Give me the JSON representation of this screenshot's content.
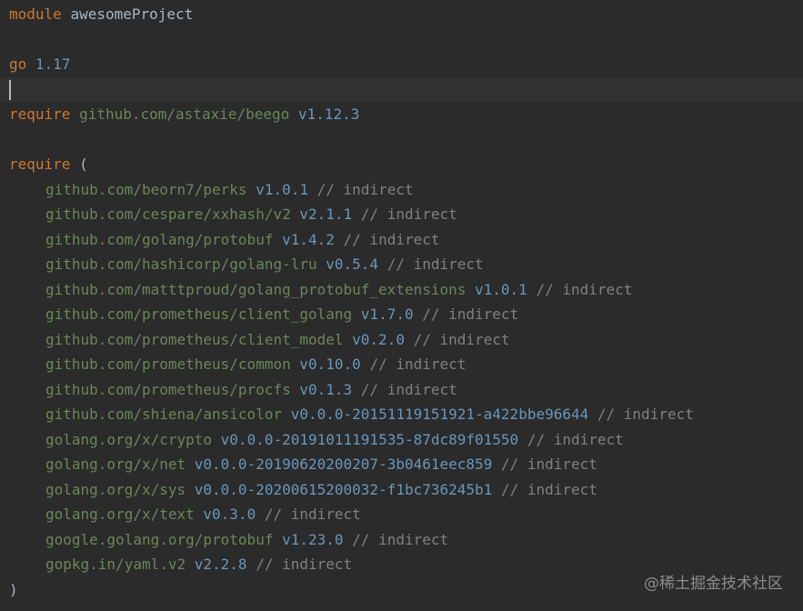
{
  "editor": {
    "module_line": {
      "keyword": "module",
      "name": "awesomeProject"
    },
    "go_line": {
      "keyword": "go",
      "version": "1.17"
    },
    "require_single": {
      "keyword": "require",
      "path": "github.com/astaxie/beego",
      "version": "v1.12.3"
    },
    "require_block_open": {
      "keyword": "require",
      "paren": "("
    },
    "require_block_close": ")",
    "deps": [
      {
        "path": "github.com/beorn7/perks",
        "version": "v1.0.1",
        "comment": "// indirect"
      },
      {
        "path": "github.com/cespare/xxhash/v2",
        "version": "v2.1.1",
        "comment": "// indirect"
      },
      {
        "path": "github.com/golang/protobuf",
        "version": "v1.4.2",
        "comment": "// indirect"
      },
      {
        "path": "github.com/hashicorp/golang-lru",
        "version": "v0.5.4",
        "comment": "// indirect"
      },
      {
        "path": "github.com/matttproud/golang_protobuf_extensions",
        "version": "v1.0.1",
        "comment": "// indirect"
      },
      {
        "path": "github.com/prometheus/client_golang",
        "version": "v1.7.0",
        "comment": "// indirect"
      },
      {
        "path": "github.com/prometheus/client_model",
        "version": "v0.2.0",
        "comment": "// indirect"
      },
      {
        "path": "github.com/prometheus/common",
        "version": "v0.10.0",
        "comment": "// indirect"
      },
      {
        "path": "github.com/prometheus/procfs",
        "version": "v0.1.3",
        "comment": "// indirect"
      },
      {
        "path": "github.com/shiena/ansicolor",
        "version": "v0.0.0-20151119151921-a422bbe96644",
        "comment": "// indirect"
      },
      {
        "path": "golang.org/x/crypto",
        "version": "v0.0.0-20191011191535-87dc89f01550",
        "comment": "// indirect"
      },
      {
        "path": "golang.org/x/net",
        "version": "v0.0.0-20190620200207-3b0461eec859",
        "comment": "// indirect"
      },
      {
        "path": "golang.org/x/sys",
        "version": "v0.0.0-20200615200032-f1bc736245b1",
        "comment": "// indirect"
      },
      {
        "path": "golang.org/x/text",
        "version": "v0.3.0",
        "comment": "// indirect"
      },
      {
        "path": "google.golang.org/protobuf",
        "version": "v1.23.0",
        "comment": "// indirect"
      },
      {
        "path": "gopkg.in/yaml.v2",
        "version": "v2.2.8",
        "comment": "// indirect"
      }
    ]
  },
  "watermark": "@稀土掘金技术社区",
  "colors": {
    "background": "#2b2b2b",
    "current_line": "#323232",
    "keyword": "#cc7832",
    "string_path": "#6a8759",
    "version": "#6897bb",
    "comment": "#808080"
  }
}
